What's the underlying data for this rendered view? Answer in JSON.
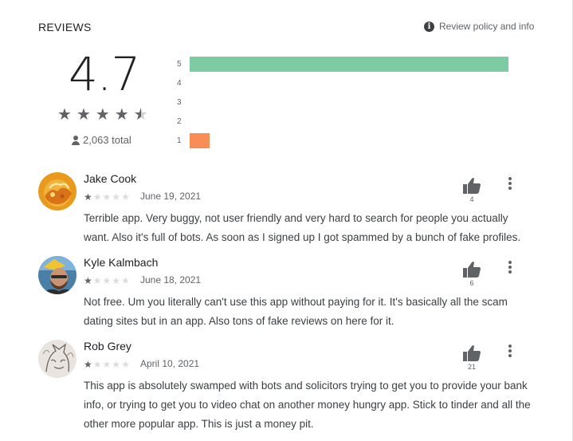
{
  "header": {
    "title": "REVIEWS",
    "policy_link": "Review policy and info",
    "info_icon_glyph": "i"
  },
  "summary": {
    "rating": "4.7",
    "stars_filled": 4.5,
    "total": "2,063 total",
    "histogram": [
      {
        "label": "5",
        "fraction": 0.965,
        "color": "#7ccba3"
      },
      {
        "label": "4",
        "fraction": 0,
        "color": "#7ccba3"
      },
      {
        "label": "3",
        "fraction": 0,
        "color": "#7ccba3"
      },
      {
        "label": "2",
        "fraction": 0,
        "color": "#7ccba3"
      },
      {
        "label": "1",
        "fraction": 0.06,
        "color": "#f88d57"
      }
    ]
  },
  "reviews": [
    {
      "name": "Jake Cook",
      "stars": 1,
      "date": "June 19, 2021",
      "helpful_count": "4",
      "text": "Terrible app. Very buggy, not user friendly and very hard to search for people you actually want. Also it's full of bots. As soon as I signed up I got spammed by a bunch of fake profiles."
    },
    {
      "name": "Kyle Kalmbach",
      "stars": 1,
      "date": "June 18, 2021",
      "helpful_count": "6",
      "text": "Not free. Um you literally can't use this app without paying for it. It's basically all the scam dating sites but in an app. Also tons of fake reviews on here for it."
    },
    {
      "name": "Rob Grey",
      "stars": 1,
      "date": "April 10, 2021",
      "helpful_count": "21",
      "text": "This app is absolutely swamped with bots and solicitors trying to get you to provide your bank info, or trying to get you to video chat on another money hungry app. Stick to tinder and all the other more popular app. This is just a money pit."
    }
  ],
  "icons": {
    "star": "★",
    "thumbs_up": "thumbs-up-icon",
    "more": "more-vert-icon",
    "person": "person-icon"
  }
}
